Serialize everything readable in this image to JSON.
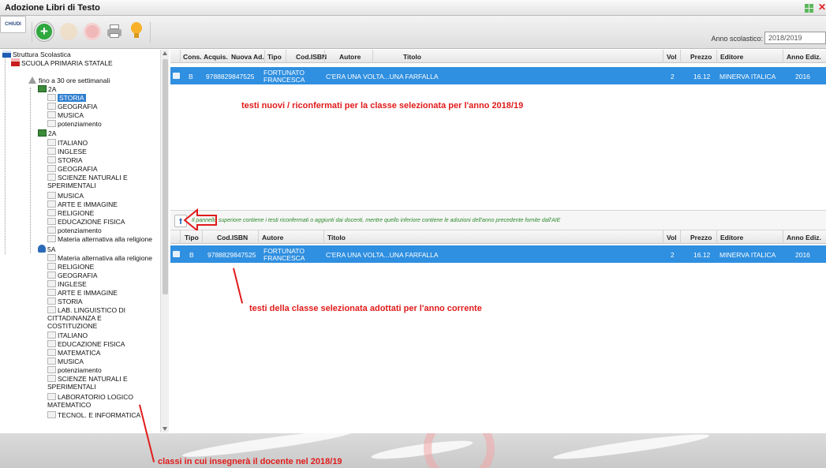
{
  "window": {
    "title": "Adozione Libri di Testo",
    "close_glyph": "✕"
  },
  "toolbar": {
    "chiudi_label": "CHIUDI",
    "add_glyph": "+",
    "anno_label": "Anno scolastico:",
    "anno_value": "2018/2019",
    "icons": [
      "add-icon",
      "edit-icon",
      "delete-icon",
      "print-icon",
      "lightbulb-icon"
    ]
  },
  "tree": {
    "root": "Struttura Scolastica",
    "school": "SCUOLA PRIMARIA STATALE",
    "orario": "fino a 30 ore settimanali",
    "class_a": {
      "name": "2A",
      "subjects": [
        "STORIA",
        "GEOGRAFIA",
        "MUSICA",
        "potenziamento"
      ],
      "selected": "STORIA"
    },
    "class_b": {
      "name": "2A",
      "subjects": [
        "ITALIANO",
        "INGLESE",
        "STORIA",
        "GEOGRAFIA",
        "SCIENZE NATURALI E SPERIMENTALI",
        "MUSICA",
        "ARTE E IMMAGINE",
        "RELIGIONE",
        "EDUCAZIONE FISICA",
        "potenziamento",
        "Materia alternativa alla religione"
      ]
    },
    "class_c": {
      "name": "5A",
      "subjects": [
        "Materia alternativa alla religione",
        "RELIGIONE",
        "GEOGRAFIA",
        "INGLESE",
        "ARTE E IMMAGINE",
        "STORIA",
        "LAB. LINGUISTICO DI CITTADINANZA E COSTITUZIONE",
        "ITALIANO",
        "EDUCAZIONE FISICA",
        "MATEMATICA",
        "MUSICA",
        "potenziamento",
        "SCIENZE NATURALI E SPERIMENTALI",
        "LABORATORIO LOGICO MATEMATICO",
        "TECNOL. E INFORMATICA"
      ]
    }
  },
  "top_grid": {
    "columns": [
      "Cons.",
      "Acquis.",
      "Nuova Ad.",
      "Tipo",
      "Cod.ISBN",
      "Autore",
      "Titolo",
      "Vol",
      "Prezzo",
      "Editore",
      "Anno Ediz."
    ],
    "row": {
      "tipo": "B",
      "isbn": "9788829847525",
      "autore_1": "FORTUNATO",
      "autore_2": "FRANCESCA",
      "titolo": "C'ERA UNA VOLTA...UNA FARFALLA",
      "vol": "2",
      "prezzo": "16.12",
      "editore": "MINERVA ITALICA",
      "anno": "2016"
    }
  },
  "mid_note": "Il pannello superiore contiene i testi riconfermati o aggiunti dai docenti, mentre quello inferiore contiene le adozioni dell'anno precedente fornite dall'AIE",
  "bottom_grid": {
    "columns": [
      "Tipo",
      "Cod.ISBN",
      "Autore",
      "Titolo",
      "Vol",
      "Prezzo",
      "Editore",
      "Anno Ediz."
    ],
    "row": {
      "tipo": "B",
      "isbn": "9788829847525",
      "autore_1": "FORTUNATO",
      "autore_2": "FRANCESCA",
      "titolo": "C'ERA UNA VOLTA...UNA FARFALLA",
      "vol": "2",
      "prezzo": "16.12",
      "editore": "MINERVA ITALICA",
      "anno": "2016"
    }
  },
  "annotations": {
    "top": "testi nuovi / riconfermati per la classe selezionata per l'anno 2018/19",
    "bottom": "testi della classe selezionata adottati per l'anno corrente",
    "left": "classi in cui insegnerà il docente nel 2018/19"
  },
  "colors": {
    "selection": "#2f8fe0",
    "annotation": "#e11b1b",
    "note": "#2b8a2b"
  }
}
